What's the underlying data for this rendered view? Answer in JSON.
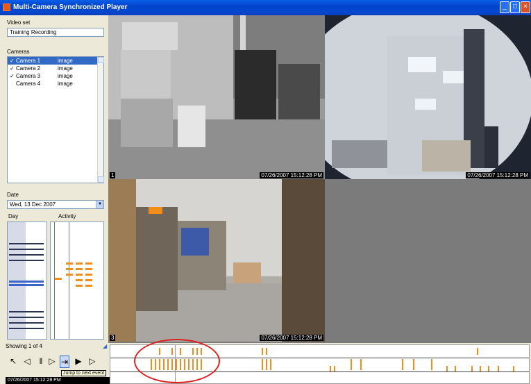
{
  "window": {
    "title": "Multi-Camera Synchronized Player",
    "controls": [
      "_",
      "□",
      "×"
    ]
  },
  "left": {
    "video_set_label": "Video set",
    "video_set_value": "Training Recording",
    "cameras_label": "Cameras",
    "cameras": [
      {
        "checked": true,
        "name": "Camera 1",
        "type": "image",
        "selected": true
      },
      {
        "checked": true,
        "name": "Camera 2",
        "type": "image",
        "selected": false
      },
      {
        "checked": true,
        "name": "Camera 3",
        "type": "image",
        "selected": false
      },
      {
        "checked": false,
        "name": "Camera 4",
        "type": "image",
        "selected": false
      }
    ],
    "date_label": "Date",
    "date_value": "Wed, 13 Dec 2007",
    "mini_left_label": "Day",
    "mini_right_label": "Activity"
  },
  "cameras_view": [
    {
      "index": "1",
      "timestamp": "07/26/2007 15:12:28 PM",
      "scene": "office-boxes"
    },
    {
      "index": "2",
      "timestamp": "07/26/2007 15:12:28 PM",
      "scene": "ceiling-fisheye"
    },
    {
      "index": "3",
      "timestamp": "07/26/2007 15:12:28 PM",
      "scene": "cubicle"
    }
  ],
  "status": {
    "left_text": "Showing 1 of 4",
    "tooltip": "Jump to next event",
    "current_time": "07/26/2007 15:12:28 PM"
  },
  "playback": {
    "buttons": [
      "previous",
      "play-reverse",
      "pause",
      "step",
      "play",
      "next"
    ]
  },
  "colors": {
    "accent": "#316ac5",
    "event": "#f28c1a",
    "highlight": "#e02020"
  }
}
